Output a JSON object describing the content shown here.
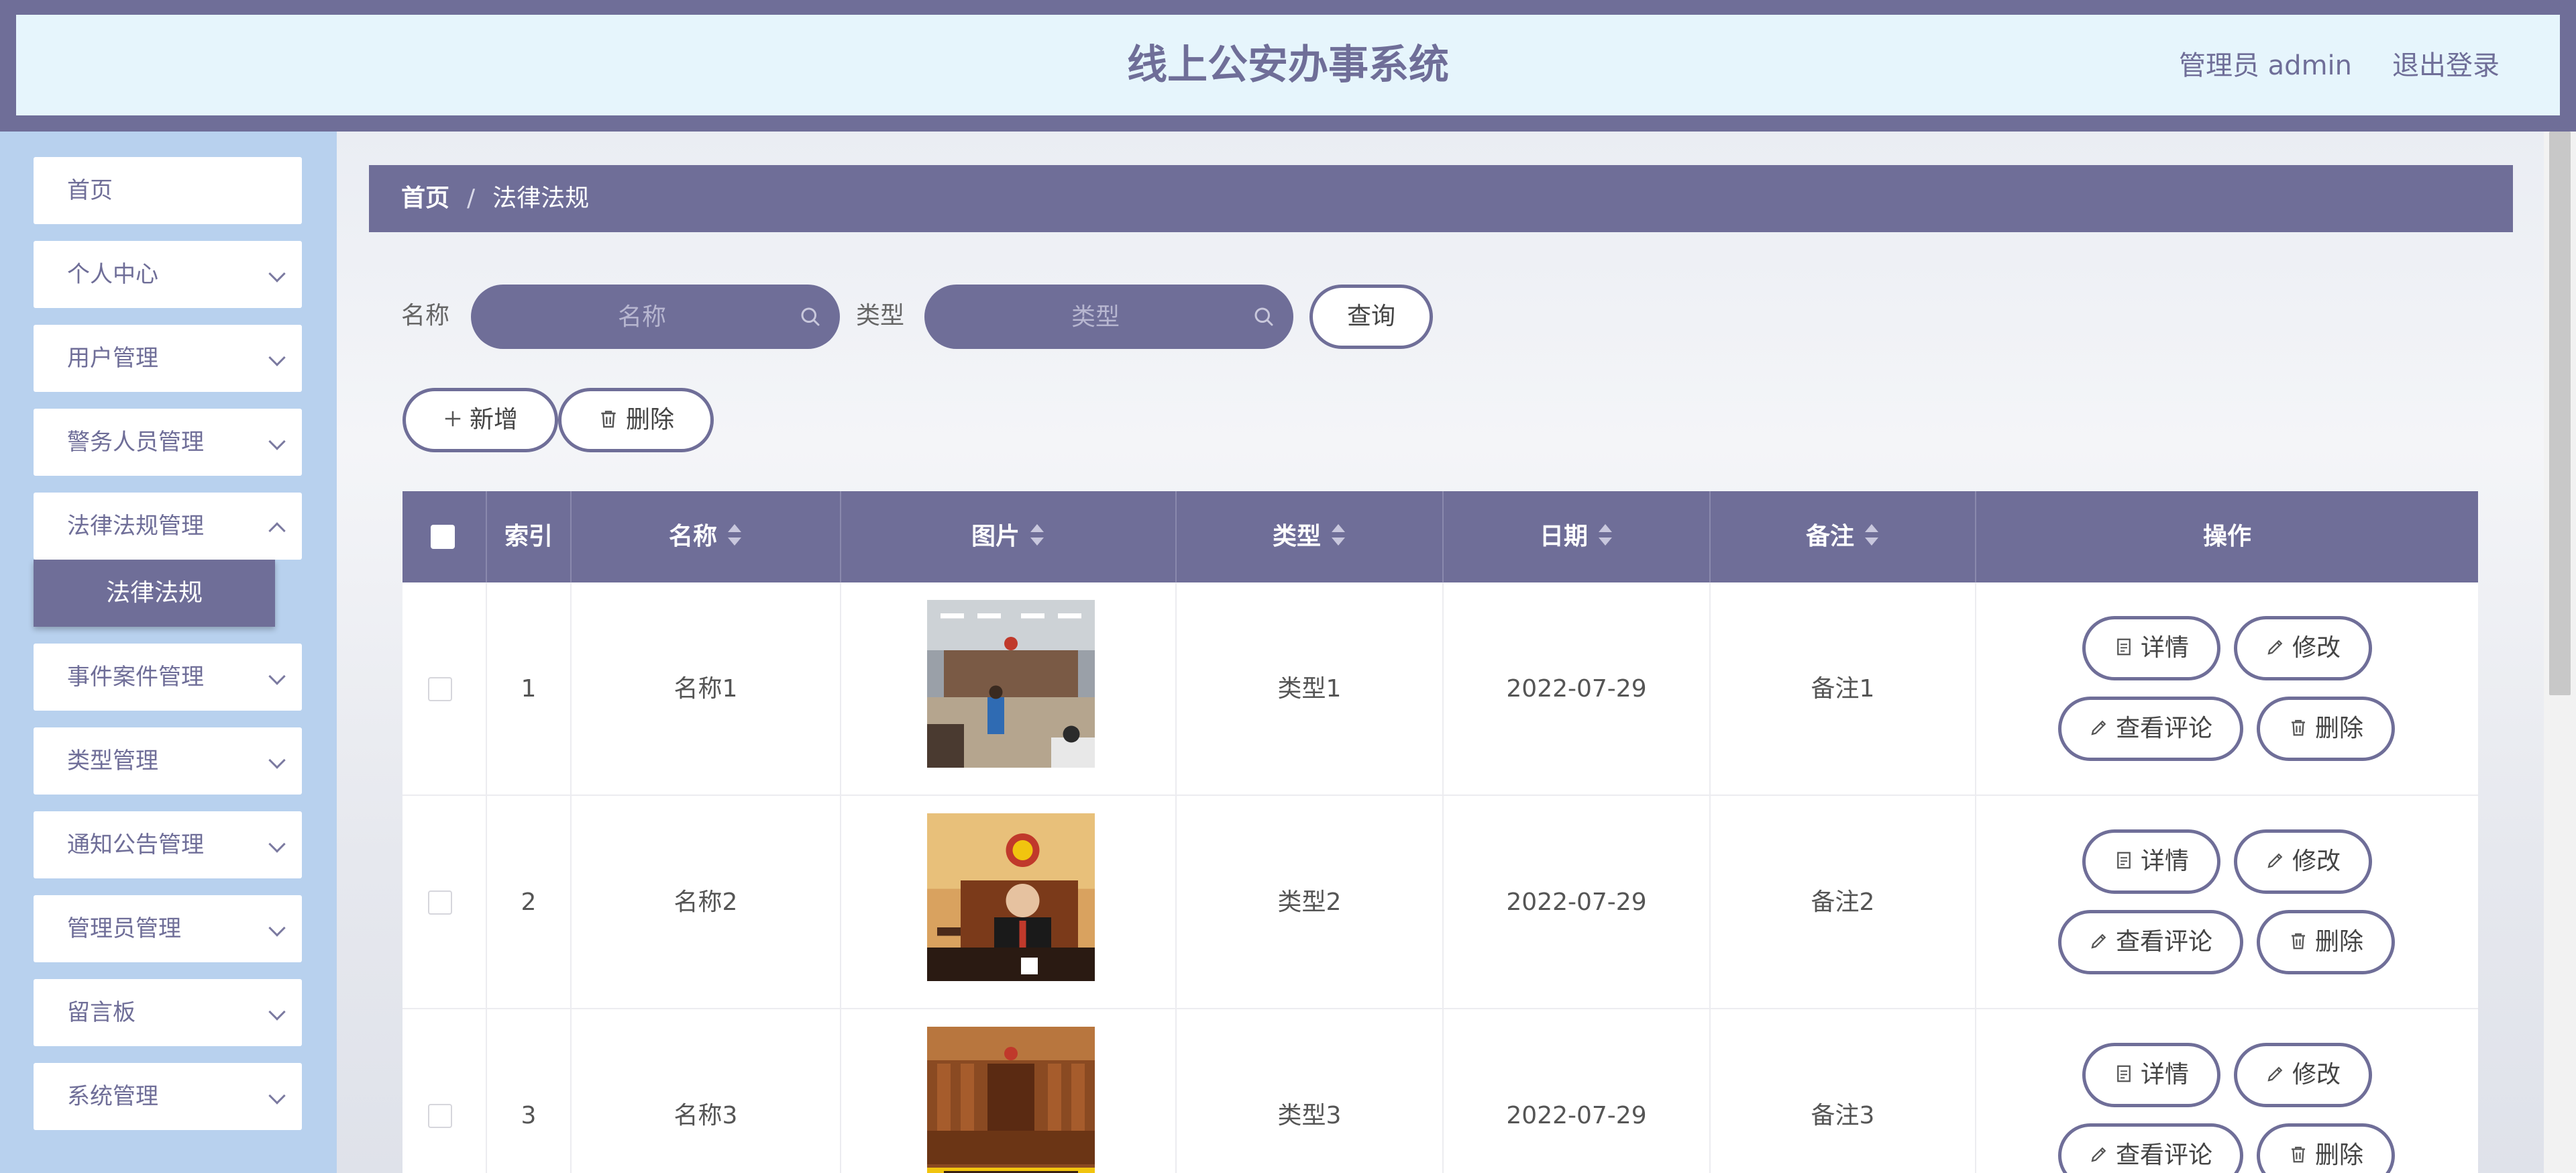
{
  "header": {
    "title": "线上公安办事系统",
    "user": "管理员 admin",
    "logout": "退出登录"
  },
  "sidebar": {
    "items": [
      {
        "label": "首页",
        "has_children": false
      },
      {
        "label": "个人中心",
        "has_children": true
      },
      {
        "label": "用户管理",
        "has_children": true
      },
      {
        "label": "警务人员管理",
        "has_children": true
      },
      {
        "label": "法律法规管理",
        "has_children": true
      },
      {
        "label": "事件案件管理",
        "has_children": true
      },
      {
        "label": "类型管理",
        "has_children": true
      },
      {
        "label": "通知公告管理",
        "has_children": true
      },
      {
        "label": "管理员管理",
        "has_children": true
      },
      {
        "label": "留言板",
        "has_children": true
      },
      {
        "label": "系统管理",
        "has_children": true
      }
    ],
    "active_submenu": "法律法规"
  },
  "breadcrumb": {
    "home": "首页",
    "separator": "/",
    "current": "法律法规"
  },
  "search": {
    "name_label": "名称",
    "name_placeholder": "名称",
    "type_label": "类型",
    "type_placeholder": "类型",
    "query_button": "查询"
  },
  "toolbar": {
    "add_label": "新增",
    "delete_label": "删除"
  },
  "table": {
    "columns": [
      "索引",
      "名称",
      "图片",
      "类型",
      "日期",
      "备注",
      "操作"
    ],
    "rows": [
      {
        "index": "1",
        "name": "名称1",
        "image": "courtroom-hearing-photo",
        "type": "类型1",
        "date": "2022-07-29",
        "note": "备注1"
      },
      {
        "index": "2",
        "name": "名称2",
        "image": "judge-with-gavel-photo",
        "type": "类型2",
        "date": "2022-07-29",
        "note": "备注2"
      },
      {
        "index": "3",
        "name": "名称3",
        "image": "wooden-courtroom-photo",
        "type": "类型3",
        "date": "2022-07-29",
        "note": "备注3"
      }
    ],
    "actions": {
      "detail": "详情",
      "edit": "修改",
      "comments": "查看评论",
      "delete": "删除"
    }
  },
  "colors": {
    "primary": "#6f6e98",
    "header_bg": "#e6f5fc",
    "sidebar_bg": "#b8d1ee"
  }
}
